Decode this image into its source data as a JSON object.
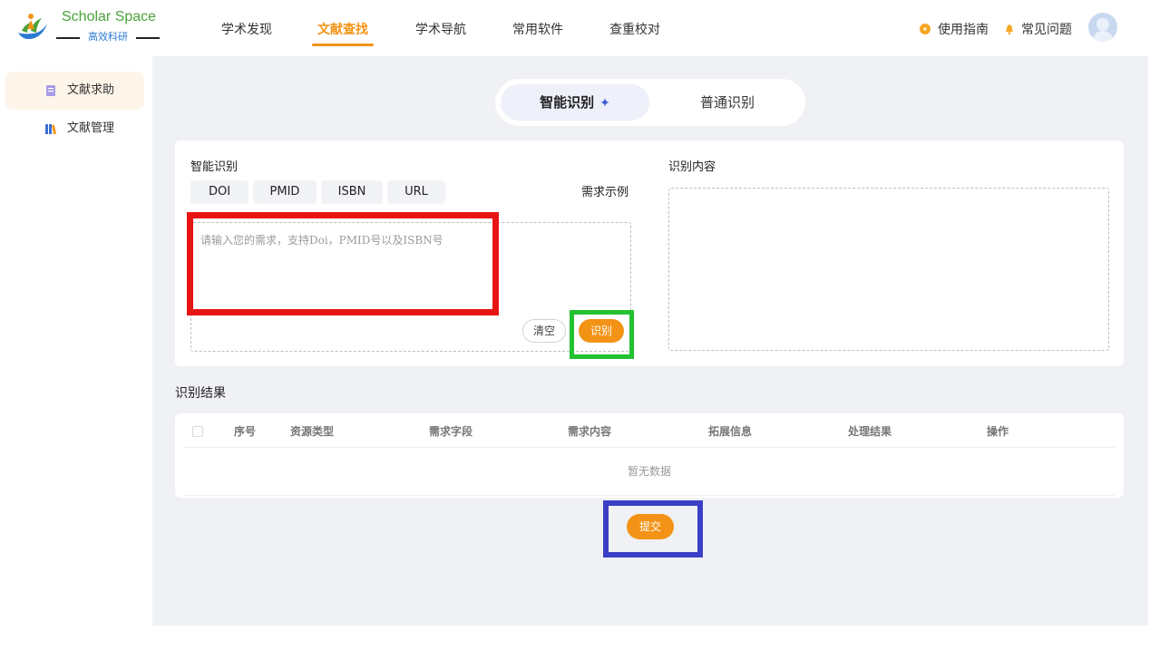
{
  "brand": {
    "title": "Scholar Space",
    "subtitle": "高效科研",
    "colors": {
      "title": "#4aa23a",
      "subtitle": "#2b7bd0"
    }
  },
  "nav": {
    "items": [
      {
        "label": "学术发现"
      },
      {
        "label": "文献查找",
        "active": true
      },
      {
        "label": "学术导航"
      },
      {
        "label": "常用软件"
      },
      {
        "label": "查重校对"
      }
    ],
    "guide_label": "使用指南",
    "faq_label": "常见问题",
    "accent": "#f39316"
  },
  "sidebar": {
    "items": [
      {
        "label": "文献求助",
        "icon": "document-icon",
        "active": true
      },
      {
        "label": "文献管理",
        "icon": "books-icon"
      }
    ]
  },
  "mode": {
    "smart_label": "智能识别",
    "sparkle": "✦",
    "normal_label": "普通识别"
  },
  "input_section": {
    "title": "智能识别",
    "chips": [
      "DOI",
      "PMID",
      "ISBN",
      "URL"
    ],
    "example_link": "需求示例",
    "placeholder": "请输入您的需求，支持Doi，PMID号以及ISBN号",
    "value": "",
    "clear_label": "清空",
    "recognize_label": "识别"
  },
  "recognized_section": {
    "title": "识别内容"
  },
  "results": {
    "title": "识别结果",
    "columns": [
      "序号",
      "资源类型",
      "需求字段",
      "需求内容",
      "拓展信息",
      "处理结果",
      "操作"
    ],
    "rows": [],
    "empty_text": "暂无数据"
  },
  "submit_label": "提交"
}
